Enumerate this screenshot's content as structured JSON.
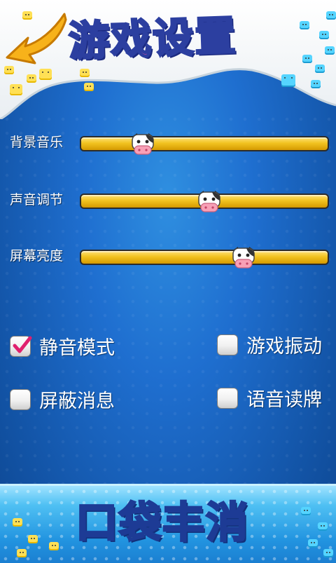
{
  "header": {
    "title": "游戏设置",
    "back_icon": "arrow-left-icon"
  },
  "sliders": [
    {
      "label": "背景音乐",
      "value": 0.25,
      "thumb_icon": "cow-face-icon"
    },
    {
      "label": "声音调节",
      "value": 0.52,
      "thumb_icon": "cow-face-icon"
    },
    {
      "label": "屏幕亮度",
      "value": 0.66,
      "thumb_icon": "cow-face-icon"
    }
  ],
  "checkboxes": [
    {
      "label": "静音模式",
      "checked": true
    },
    {
      "label": "游戏振动",
      "checked": false
    },
    {
      "label": "屏蔽消息",
      "checked": false
    },
    {
      "label": "语音读牌",
      "checked": false
    }
  ],
  "footer": {
    "logo_chars": [
      "口",
      "袋",
      "丰",
      "消"
    ],
    "logo_colors": [
      "#ffe14d",
      "#7be36a",
      "#ff7bc0",
      "#ffb347"
    ]
  },
  "colors": {
    "background": "#1f6fd0",
    "slider_fill": "#f2c320",
    "check_mark": "#e0206e",
    "title_fill": "#ff4fa0"
  }
}
